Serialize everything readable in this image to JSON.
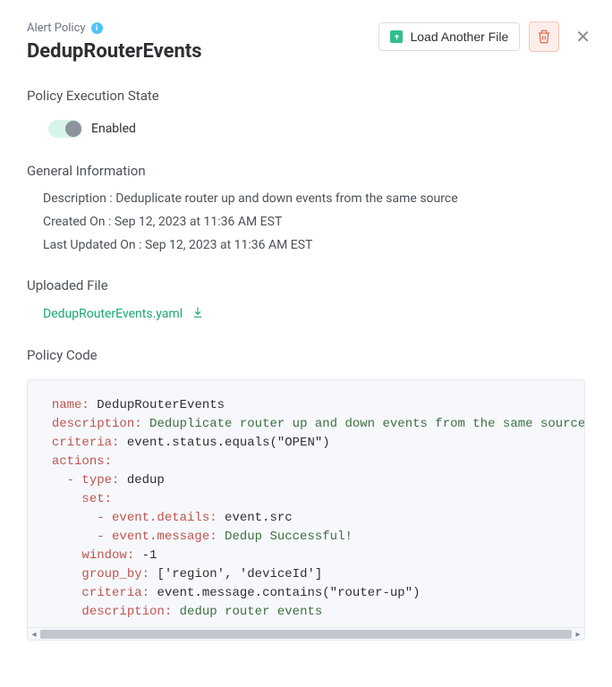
{
  "header": {
    "supertitle": "Alert Policy",
    "title": "DedupRouterEvents",
    "load_button": "Load Another File"
  },
  "execution": {
    "section": "Policy Execution State",
    "state_label": "Enabled"
  },
  "general": {
    "section": "General Information",
    "desc_label": "Description :",
    "desc_value": "Deduplicate router up and down events from the same source",
    "created_label": "Created On :",
    "created_value": "Sep 12, 2023 at 11:36 AM EST",
    "updated_label": "Last Updated On :",
    "updated_value": "Sep 12, 2023 at 11:36 AM EST"
  },
  "uploaded": {
    "section": "Uploaded File",
    "filename": "DedupRouterEvents.yaml"
  },
  "code": {
    "section": "Policy Code",
    "lines": {
      "l1k": "name:",
      "l1v": "DedupRouterEvents",
      "l2k": "description:",
      "l2v": "Deduplicate router up and down events from the same source",
      "l3k": "criteria:",
      "l3v": "event.status.equals(\"OPEN\")",
      "l4k": "actions:",
      "l5k": "- type:",
      "l5v": "dedup",
      "l6k": "set:",
      "l7k": "- event.details:",
      "l7v": "event.src",
      "l8k": "- event.message:",
      "l8v": "Dedup Successful!",
      "l9k": "window:",
      "l9v": "-1",
      "l10k": "group_by:",
      "l10v": "['region', 'deviceId']",
      "l11k": "criteria:",
      "l11v": "event.message.contains(\"router-up\")",
      "l12k": "description:",
      "l12v": "dedup router events"
    }
  }
}
